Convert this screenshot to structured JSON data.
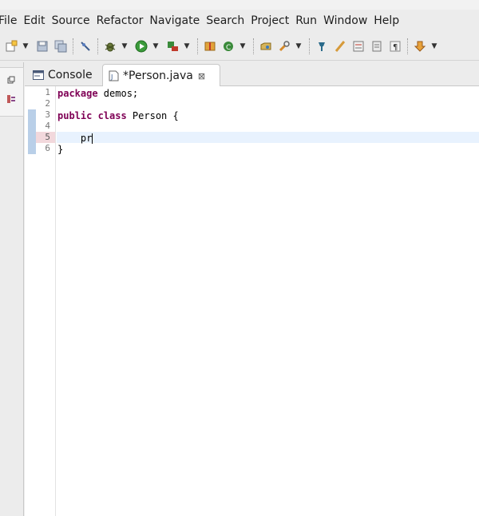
{
  "menubar": {
    "items": [
      "File",
      "Edit",
      "Source",
      "Refactor",
      "Navigate",
      "Search",
      "Project",
      "Run",
      "Window",
      "Help"
    ]
  },
  "toolbar": {
    "icons": [
      "new-wizard-icon",
      "save-icon",
      "save-all-icon",
      "skip-breakpoints-icon",
      "debug-icon",
      "run-icon",
      "run-external-tools-icon",
      "new-java-package-icon",
      "new-java-class-icon",
      "open-type-icon",
      "search-icon",
      "toggle-mark-occurrences-icon",
      "edit-icon",
      "block-selection-icon",
      "show-whitespace-icon",
      "next-annotation-icon"
    ]
  },
  "tabs": [
    {
      "label": "Console",
      "icon": "console-icon",
      "active": false
    },
    {
      "label": "*Person.java",
      "icon": "java-file-icon",
      "active": true,
      "close": "⊠"
    }
  ],
  "editor": {
    "line_numbers": [
      "1",
      "2",
      "3",
      "4",
      "5",
      "6"
    ],
    "current_line": 5,
    "lines": [
      {
        "kw": "package",
        "rest": " demos;"
      },
      {
        "kw": "",
        "rest": ""
      },
      {
        "kw": "public class",
        "rest": " Person {"
      },
      {
        "kw": "",
        "rest": ""
      },
      {
        "kw": "",
        "rest": "    pr"
      },
      {
        "kw": "",
        "rest": "}"
      }
    ]
  },
  "colors": {
    "keyword": "#7f0055",
    "current_line": "#e8f2fe",
    "change_marker": "#b9cfe8"
  }
}
